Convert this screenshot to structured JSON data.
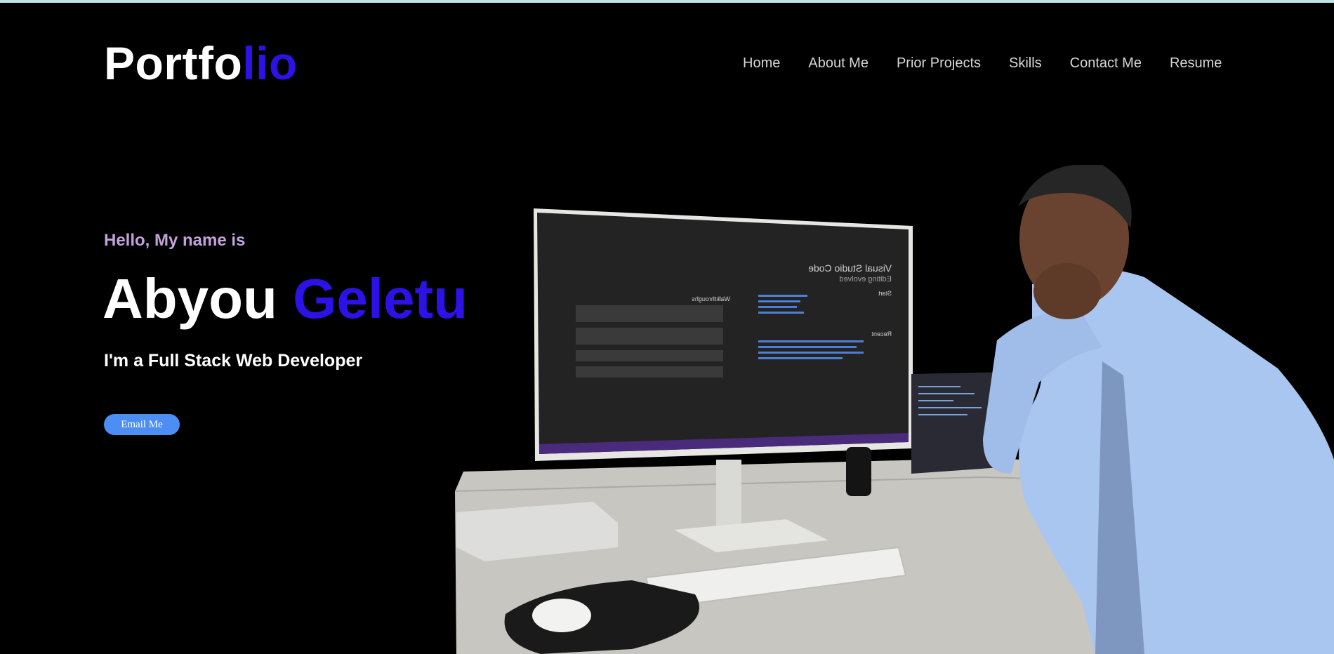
{
  "logo": {
    "part1": "Portfo",
    "part2": "lio"
  },
  "nav": {
    "home": "Home",
    "about": "About Me",
    "projects": "Prior Projects",
    "skills": "Skills",
    "contact": "Contact Me",
    "resume": "Resume"
  },
  "hero": {
    "greeting": "Hello, My name is",
    "first_name": "Abyou",
    "last_name": "Geletu",
    "role": "I'm a Full Stack Web Developer",
    "email_button": "Email Me"
  },
  "photo": {
    "monitor": {
      "title": "Visual Studio Code",
      "subtitle": "Editing evolved",
      "start_label": "Start",
      "recent_label": "Recent",
      "walkthroughs_label": "Walkthroughs"
    },
    "icon": "developer-at-desk-photo"
  },
  "colors": {
    "background": "#000000",
    "accent": "#2d12e8",
    "greeting": "#c3a2dc",
    "button": "#4d8ef5",
    "nav_text": "#d7d7d7"
  }
}
